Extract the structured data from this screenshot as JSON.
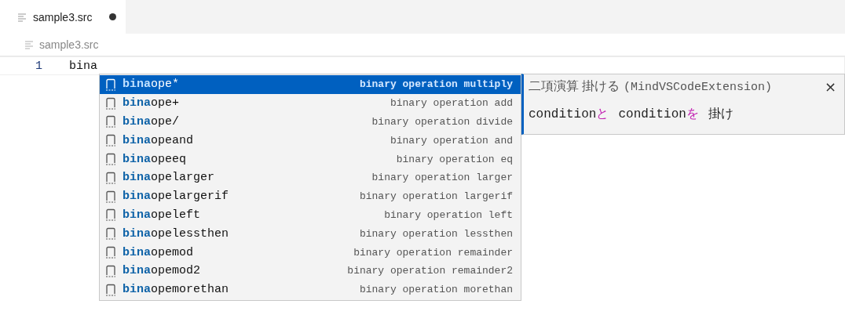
{
  "tabs": [
    {
      "label": "sample3.src",
      "selected": true,
      "dirty": true
    }
  ],
  "breadcrumb": "sample3.src",
  "editor": {
    "lines": [
      {
        "number": "1",
        "text": "bina"
      }
    ]
  },
  "suggestions": [
    {
      "match": "bina",
      "rest": "ope*",
      "detail": "binary operation multiply",
      "selected": true
    },
    {
      "match": "bina",
      "rest": "ope+",
      "detail": "binary operation add",
      "selected": false
    },
    {
      "match": "bina",
      "rest": "ope/",
      "detail": "binary operation divide",
      "selected": false
    },
    {
      "match": "bina",
      "rest": "opeand",
      "detail": "binary operation and",
      "selected": false
    },
    {
      "match": "bina",
      "rest": "opeeq",
      "detail": "binary operation eq",
      "selected": false
    },
    {
      "match": "bina",
      "rest": "opelarger",
      "detail": "binary operation larger",
      "selected": false
    },
    {
      "match": "bina",
      "rest": "opelargerif",
      "detail": "binary operation largerif",
      "selected": false
    },
    {
      "match": "bina",
      "rest": "opeleft",
      "detail": "binary operation left",
      "selected": false
    },
    {
      "match": "bina",
      "rest": "opelessthen",
      "detail": "binary operation lessthen",
      "selected": false
    },
    {
      "match": "bina",
      "rest": "opemod",
      "detail": "binary operation remainder",
      "selected": false
    },
    {
      "match": "bina",
      "rest": "opemod2",
      "detail": "binary operation remainder2",
      "selected": false
    },
    {
      "match": "bina",
      "rest": "opemorethan",
      "detail": "binary operation morethan",
      "selected": false
    }
  ],
  "details": {
    "title": "二項演算 掛ける",
    "source": "(MindVSCodeExtension)",
    "close": "×",
    "tokens": [
      {
        "text": "condition",
        "kind": "word"
      },
      {
        "text": "と",
        "kind": "particle"
      },
      {
        "text": "condition",
        "kind": "word"
      },
      {
        "text": "を",
        "kind": "particle"
      },
      {
        "text": "掛け",
        "kind": "word"
      }
    ]
  }
}
